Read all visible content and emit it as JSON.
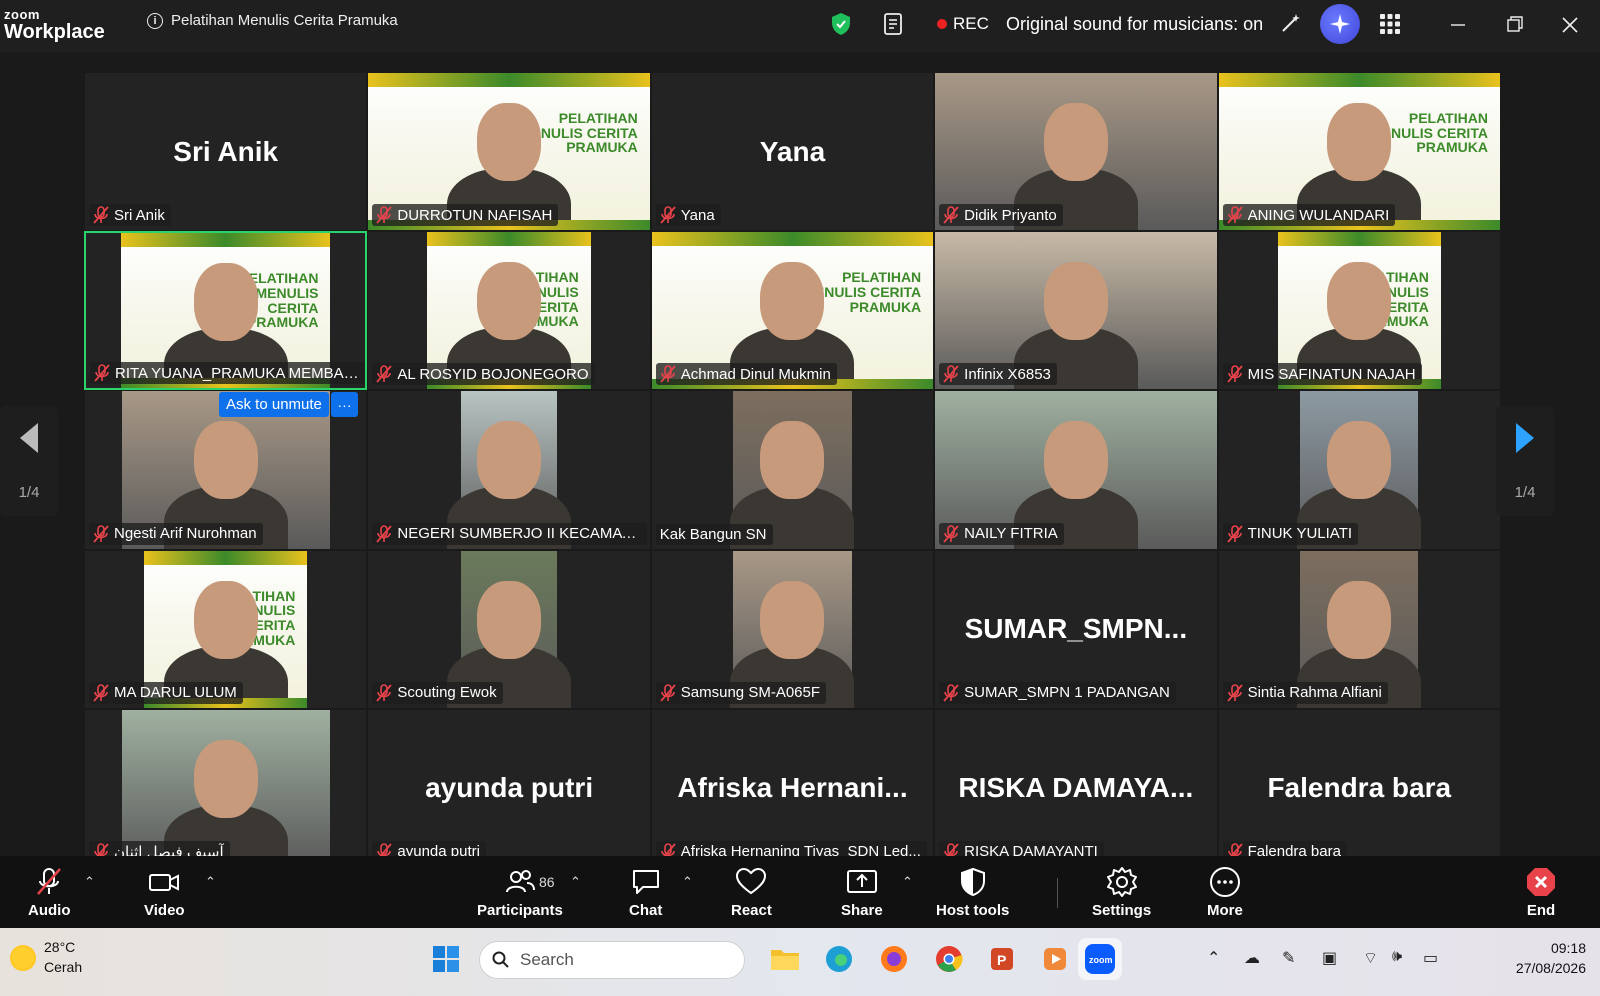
{
  "app": {
    "logo_small": "zoom",
    "logo_big": "Workplace",
    "meeting_title": "Pelatihan Menulis Cerita Pramuka",
    "rec_label": "REC",
    "original_sound": "Original sound for musicians: on"
  },
  "banner_text": "PELATIHAN MENULIS CERITA PRAMUKA",
  "tiles": [
    {
      "name": "Sri Anik",
      "big": "Sri Anik",
      "type": "name"
    },
    {
      "name": "DURROTUN NAFISAH",
      "type": "banner"
    },
    {
      "name": "Yana",
      "big": "Yana",
      "type": "name"
    },
    {
      "name": "Didik Priyanto",
      "type": "cam"
    },
    {
      "name": "ANING WULANDARI",
      "type": "banner"
    },
    {
      "name": "RITA YUANA_PRAMUKA MEMBAN...",
      "type": "banner"
    },
    {
      "name": "AL ROSYID BOJONEGORO",
      "type": "banner"
    },
    {
      "name": "Achmad Dinul Mukmin",
      "type": "banner"
    },
    {
      "name": "Infinix X6853",
      "type": "cam"
    },
    {
      "name": "MIS SAFINATUN NAJAH",
      "type": "banner"
    },
    {
      "name": "Ngesti Arif Nurohman",
      "type": "cam"
    },
    {
      "name": "NEGERI SUMBERJO II KECAMATA...",
      "type": "cam"
    },
    {
      "name": "Kak Bangun SN",
      "type": "cam"
    },
    {
      "name": "NAILY FITRIA",
      "type": "cam"
    },
    {
      "name": "TINUK YULIATI",
      "type": "cam"
    },
    {
      "name": "MA DARUL ULUM",
      "type": "banner"
    },
    {
      "name": "Scouting Ewok",
      "type": "cam"
    },
    {
      "name": "Samsung SM-A065F",
      "type": "cam"
    },
    {
      "name": "SUMAR_SMPN 1 PADANGAN",
      "big": "SUMAR_SMPN...",
      "type": "name"
    },
    {
      "name": "Sintia Rahma Alfiani",
      "type": "cam"
    },
    {
      "name": "آسیف فیصل اثنان",
      "type": "cam"
    },
    {
      "name": "ayunda putri",
      "big": "ayunda putri",
      "type": "name"
    },
    {
      "name": "Afriska Hernaning Tiyas_SDN Led...",
      "big": "Afriska  Hernani...",
      "type": "name"
    },
    {
      "name": "RISKA DAMAYANTI",
      "big": "RISKA  DAMAYA...",
      "type": "name"
    },
    {
      "name": "Falendra bara",
      "big": "Falendra bara",
      "type": "name"
    }
  ],
  "ask_unmute": "Ask to unmute",
  "pager": {
    "left": "1/4",
    "right": "1/4"
  },
  "toolbar": {
    "audio": "Audio",
    "video": "Video",
    "participants": "Participants",
    "participants_count": "86",
    "chat": "Chat",
    "react": "React",
    "share": "Share",
    "host_tools": "Host tools",
    "settings": "Settings",
    "more": "More",
    "end": "End"
  },
  "taskbar": {
    "temp": "28°C",
    "weather": "Cerah",
    "search_placeholder": "Search",
    "time": "09:18",
    "date": "27/08/2026"
  }
}
